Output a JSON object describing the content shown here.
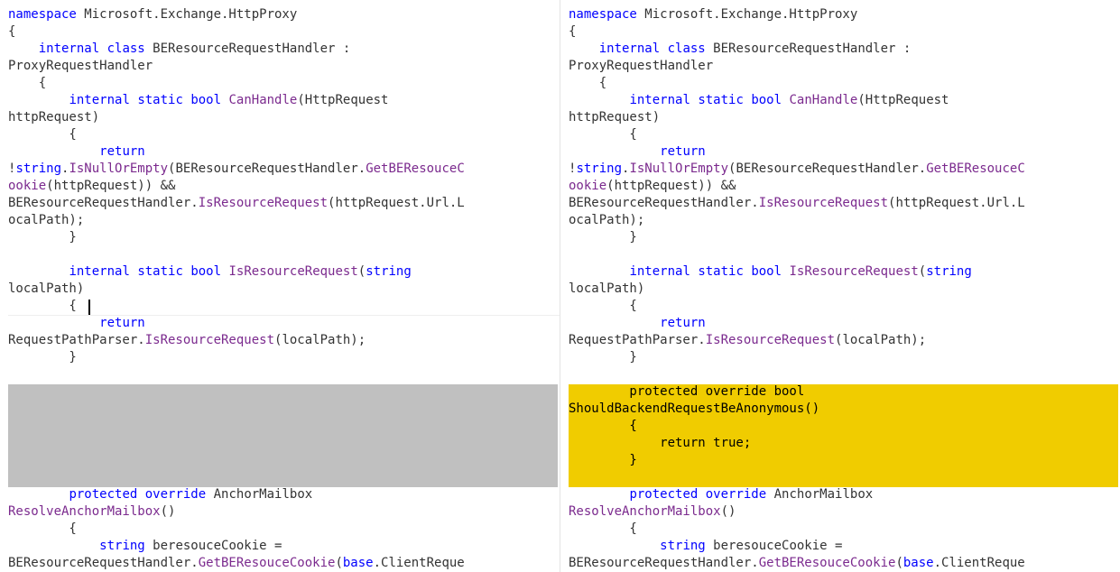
{
  "colors": {
    "keyword": "#0000ff",
    "method": "#7b2a8e",
    "plain": "#333333",
    "added_text": "#000000",
    "removed_block": "#c0c0c0",
    "added_block": "#f0cc00"
  },
  "left_pane": {
    "lines": [
      {
        "row": 0,
        "tokens": [
          {
            "t": "namespace",
            "k": "kw"
          },
          {
            "t": " Microsoft.Exchange.HttpProxy",
            "k": "p"
          }
        ]
      },
      {
        "row": 1,
        "tokens": [
          {
            "t": "{",
            "k": "p"
          }
        ]
      },
      {
        "row": 2,
        "tokens": [
          {
            "t": "    ",
            "k": "p"
          },
          {
            "t": "internal",
            "k": "kw"
          },
          {
            "t": " ",
            "k": "p"
          },
          {
            "t": "class",
            "k": "kw"
          },
          {
            "t": " BEResourceRequestHandler :",
            "k": "p"
          }
        ]
      },
      {
        "row": 3,
        "tokens": [
          {
            "t": "ProxyRequestHandler",
            "k": "p"
          }
        ]
      },
      {
        "row": 4,
        "tokens": [
          {
            "t": "    {",
            "k": "p"
          }
        ]
      },
      {
        "row": 5,
        "tokens": [
          {
            "t": "        ",
            "k": "p"
          },
          {
            "t": "internal",
            "k": "kw"
          },
          {
            "t": " ",
            "k": "p"
          },
          {
            "t": "static",
            "k": "kw"
          },
          {
            "t": " ",
            "k": "p"
          },
          {
            "t": "bool",
            "k": "kw"
          },
          {
            "t": " ",
            "k": "p"
          },
          {
            "t": "CanHandle",
            "k": "m"
          },
          {
            "t": "(HttpRequest",
            "k": "p"
          }
        ]
      },
      {
        "row": 6,
        "tokens": [
          {
            "t": "httpRequest)",
            "k": "p"
          }
        ]
      },
      {
        "row": 7,
        "tokens": [
          {
            "t": "        {",
            "k": "p"
          }
        ]
      },
      {
        "row": 8,
        "tokens": [
          {
            "t": "            ",
            "k": "p"
          },
          {
            "t": "return",
            "k": "kw"
          }
        ]
      },
      {
        "row": 9,
        "tokens": [
          {
            "t": "!",
            "k": "p"
          },
          {
            "t": "string",
            "k": "kw"
          },
          {
            "t": ".",
            "k": "p"
          },
          {
            "t": "IsNullOrEmpty",
            "k": "m"
          },
          {
            "t": "(BEResourceRequestHandler.",
            "k": "p"
          },
          {
            "t": "GetBEResouceC",
            "k": "m"
          }
        ]
      },
      {
        "row": 10,
        "tokens": [
          {
            "t": "ookie",
            "k": "m"
          },
          {
            "t": "(httpRequest)) && ",
            "k": "p"
          }
        ]
      },
      {
        "row": 11,
        "tokens": [
          {
            "t": "BEResourceRequestHandler.",
            "k": "p"
          },
          {
            "t": "IsResourceRequest",
            "k": "m"
          },
          {
            "t": "(httpRequest.Url.L",
            "k": "p"
          }
        ]
      },
      {
        "row": 12,
        "tokens": [
          {
            "t": "ocalPath);",
            "k": "p"
          }
        ]
      },
      {
        "row": 13,
        "tokens": [
          {
            "t": "        }",
            "k": "p"
          }
        ]
      },
      {
        "row": 15,
        "tokens": [
          {
            "t": "        ",
            "k": "p"
          },
          {
            "t": "internal",
            "k": "kw"
          },
          {
            "t": " ",
            "k": "p"
          },
          {
            "t": "static",
            "k": "kw"
          },
          {
            "t": " ",
            "k": "p"
          },
          {
            "t": "bool",
            "k": "kw"
          },
          {
            "t": " ",
            "k": "p"
          },
          {
            "t": "IsResourceRequest",
            "k": "m"
          },
          {
            "t": "(",
            "k": "p"
          },
          {
            "t": "string",
            "k": "kw"
          }
        ]
      },
      {
        "row": 16,
        "tokens": [
          {
            "t": "localPath)",
            "k": "p"
          }
        ]
      },
      {
        "row": 17,
        "tokens": [
          {
            "t": "        {",
            "k": "p"
          }
        ]
      },
      {
        "row": 18,
        "tokens": [
          {
            "t": "            ",
            "k": "p"
          },
          {
            "t": "return",
            "k": "kw"
          }
        ]
      },
      {
        "row": 19,
        "tokens": [
          {
            "t": "RequestPathParser.",
            "k": "p"
          },
          {
            "t": "IsResourceRequest",
            "k": "m"
          },
          {
            "t": "(localPath);",
            "k": "p"
          }
        ]
      },
      {
        "row": 20,
        "tokens": [
          {
            "t": "        }",
            "k": "p"
          }
        ]
      },
      {
        "row": 28,
        "tokens": [
          {
            "t": "        ",
            "k": "p"
          },
          {
            "t": "protected",
            "k": "kw"
          },
          {
            "t": " ",
            "k": "p"
          },
          {
            "t": "override",
            "k": "kw"
          },
          {
            "t": " AnchorMailbox",
            "k": "p"
          }
        ]
      },
      {
        "row": 29,
        "tokens": [
          {
            "t": "ResolveAnchorMailbox",
            "k": "m"
          },
          {
            "t": "()",
            "k": "p"
          }
        ]
      },
      {
        "row": 30,
        "tokens": [
          {
            "t": "        {",
            "k": "p"
          }
        ]
      },
      {
        "row": 31,
        "tokens": [
          {
            "t": "            ",
            "k": "p"
          },
          {
            "t": "string",
            "k": "kw"
          },
          {
            "t": " beresouceCookie =",
            "k": "p"
          }
        ]
      },
      {
        "row": 32,
        "tokens": [
          {
            "t": "BEResourceRequestHandler.",
            "k": "p"
          },
          {
            "t": "GetBEResouceCookie",
            "k": "m"
          },
          {
            "t": "(",
            "k": "p"
          },
          {
            "t": "base",
            "k": "kw"
          },
          {
            "t": ".ClientReque",
            "k": "p"
          }
        ]
      }
    ]
  },
  "right_pane": {
    "lines": [
      {
        "row": 0,
        "tokens": [
          {
            "t": "namespace",
            "k": "kw"
          },
          {
            "t": " Microsoft.Exchange.HttpProxy",
            "k": "p"
          }
        ]
      },
      {
        "row": 1,
        "tokens": [
          {
            "t": "{",
            "k": "p"
          }
        ]
      },
      {
        "row": 2,
        "tokens": [
          {
            "t": "    ",
            "k": "p"
          },
          {
            "t": "internal",
            "k": "kw"
          },
          {
            "t": " ",
            "k": "p"
          },
          {
            "t": "class",
            "k": "kw"
          },
          {
            "t": " BEResourceRequestHandler :",
            "k": "p"
          }
        ]
      },
      {
        "row": 3,
        "tokens": [
          {
            "t": "ProxyRequestHandler",
            "k": "p"
          }
        ]
      },
      {
        "row": 4,
        "tokens": [
          {
            "t": "    {",
            "k": "p"
          }
        ]
      },
      {
        "row": 5,
        "tokens": [
          {
            "t": "        ",
            "k": "p"
          },
          {
            "t": "internal",
            "k": "kw"
          },
          {
            "t": " ",
            "k": "p"
          },
          {
            "t": "static",
            "k": "kw"
          },
          {
            "t": " ",
            "k": "p"
          },
          {
            "t": "bool",
            "k": "kw"
          },
          {
            "t": " ",
            "k": "p"
          },
          {
            "t": "CanHandle",
            "k": "m"
          },
          {
            "t": "(HttpRequest",
            "k": "p"
          }
        ]
      },
      {
        "row": 6,
        "tokens": [
          {
            "t": "httpRequest)",
            "k": "p"
          }
        ]
      },
      {
        "row": 7,
        "tokens": [
          {
            "t": "        {",
            "k": "p"
          }
        ]
      },
      {
        "row": 8,
        "tokens": [
          {
            "t": "            ",
            "k": "p"
          },
          {
            "t": "return",
            "k": "kw"
          }
        ]
      },
      {
        "row": 9,
        "tokens": [
          {
            "t": "!",
            "k": "p"
          },
          {
            "t": "string",
            "k": "kw"
          },
          {
            "t": ".",
            "k": "p"
          },
          {
            "t": "IsNullOrEmpty",
            "k": "m"
          },
          {
            "t": "(BEResourceRequestHandler.",
            "k": "p"
          },
          {
            "t": "GetBEResouceC",
            "k": "m"
          }
        ]
      },
      {
        "row": 10,
        "tokens": [
          {
            "t": "ookie",
            "k": "m"
          },
          {
            "t": "(httpRequest)) && ",
            "k": "p"
          }
        ]
      },
      {
        "row": 11,
        "tokens": [
          {
            "t": "BEResourceRequestHandler.",
            "k": "p"
          },
          {
            "t": "IsResourceRequest",
            "k": "m"
          },
          {
            "t": "(httpRequest.Url.L",
            "k": "p"
          }
        ]
      },
      {
        "row": 12,
        "tokens": [
          {
            "t": "ocalPath);",
            "k": "p"
          }
        ]
      },
      {
        "row": 13,
        "tokens": [
          {
            "t": "        }",
            "k": "p"
          }
        ]
      },
      {
        "row": 15,
        "tokens": [
          {
            "t": "        ",
            "k": "p"
          },
          {
            "t": "internal",
            "k": "kw"
          },
          {
            "t": " ",
            "k": "p"
          },
          {
            "t": "static",
            "k": "kw"
          },
          {
            "t": " ",
            "k": "p"
          },
          {
            "t": "bool",
            "k": "kw"
          },
          {
            "t": " ",
            "k": "p"
          },
          {
            "t": "IsResourceRequest",
            "k": "m"
          },
          {
            "t": "(",
            "k": "p"
          },
          {
            "t": "string",
            "k": "kw"
          }
        ]
      },
      {
        "row": 16,
        "tokens": [
          {
            "t": "localPath)",
            "k": "p"
          }
        ]
      },
      {
        "row": 17,
        "tokens": [
          {
            "t": "        {",
            "k": "p"
          }
        ]
      },
      {
        "row": 18,
        "tokens": [
          {
            "t": "            ",
            "k": "p"
          },
          {
            "t": "return",
            "k": "kw"
          }
        ]
      },
      {
        "row": 19,
        "tokens": [
          {
            "t": "RequestPathParser.",
            "k": "p"
          },
          {
            "t": "IsResourceRequest",
            "k": "m"
          },
          {
            "t": "(localPath);",
            "k": "p"
          }
        ]
      },
      {
        "row": 20,
        "tokens": [
          {
            "t": "        }",
            "k": "p"
          }
        ]
      },
      {
        "row": 22,
        "added": true,
        "tokens": [
          {
            "t": "        protected override bool",
            "k": "a"
          }
        ]
      },
      {
        "row": 23,
        "added": true,
        "tokens": [
          {
            "t": "ShouldBackendRequestBeAnonymous()",
            "k": "a"
          }
        ]
      },
      {
        "row": 24,
        "added": true,
        "tokens": [
          {
            "t": "        {",
            "k": "a"
          }
        ]
      },
      {
        "row": 25,
        "added": true,
        "tokens": [
          {
            "t": "            return true;",
            "k": "a"
          }
        ]
      },
      {
        "row": 26,
        "added": true,
        "tokens": [
          {
            "t": "        }",
            "k": "a"
          }
        ]
      },
      {
        "row": 28,
        "tokens": [
          {
            "t": "        ",
            "k": "p"
          },
          {
            "t": "protected",
            "k": "kw"
          },
          {
            "t": " ",
            "k": "p"
          },
          {
            "t": "override",
            "k": "kw"
          },
          {
            "t": " AnchorMailbox",
            "k": "p"
          }
        ]
      },
      {
        "row": 29,
        "tokens": [
          {
            "t": "ResolveAnchorMailbox",
            "k": "m"
          },
          {
            "t": "()",
            "k": "p"
          }
        ]
      },
      {
        "row": 30,
        "tokens": [
          {
            "t": "        {",
            "k": "p"
          }
        ]
      },
      {
        "row": 31,
        "tokens": [
          {
            "t": "            ",
            "k": "p"
          },
          {
            "t": "string",
            "k": "kw"
          },
          {
            "t": " beresouceCookie =",
            "k": "p"
          }
        ]
      },
      {
        "row": 32,
        "tokens": [
          {
            "t": "BEResourceRequestHandler.",
            "k": "p"
          },
          {
            "t": "GetBEResouceCookie",
            "k": "m"
          },
          {
            "t": "(",
            "k": "p"
          },
          {
            "t": "base",
            "k": "kw"
          },
          {
            "t": ".ClientReque",
            "k": "p"
          }
        ]
      }
    ]
  }
}
